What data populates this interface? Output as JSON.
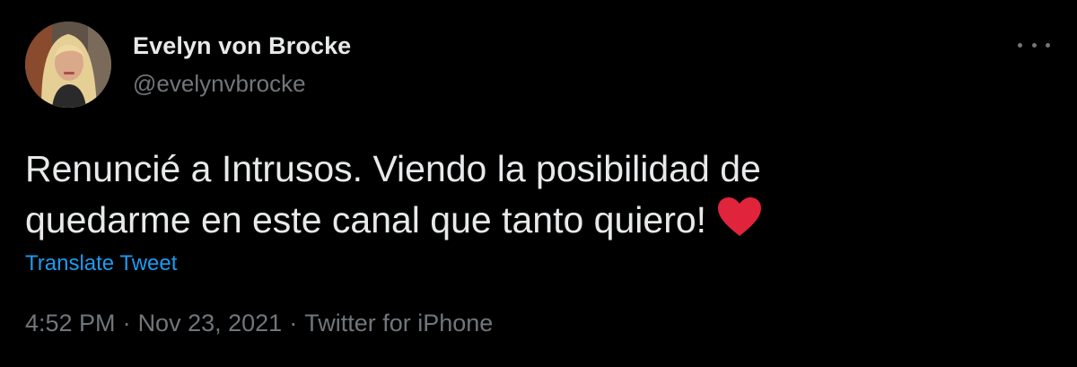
{
  "author": {
    "name": "Evelyn von Brocke",
    "handle": "@evelynvbrocke"
  },
  "tweet": {
    "line1": "Renuncié a Intrusos. Viendo la posibilidad de",
    "line2": "quedarme en este canal que tanto quiero!",
    "emoji_icon": "red-heart-icon",
    "translate_label": "Translate Tweet",
    "time": "4:52 PM",
    "separator": "·",
    "date": "Nov 23, 2021",
    "source": "Twitter for iPhone"
  },
  "colors": {
    "background": "#000000",
    "text": "#e7e9ea",
    "muted": "#71767b",
    "link": "#1d9bf0",
    "heart": "#e0243b"
  }
}
